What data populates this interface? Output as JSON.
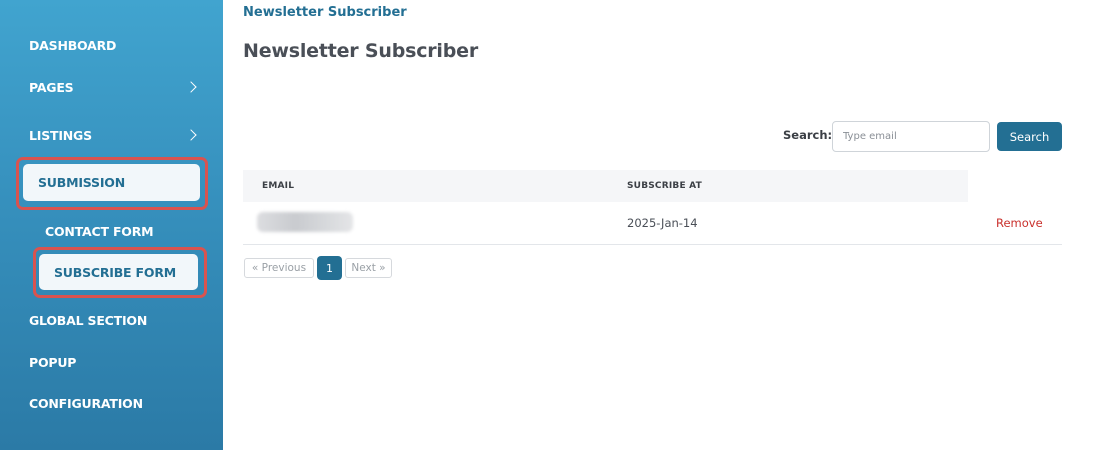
{
  "sidebar": {
    "items": [
      {
        "label": "DASHBOARD"
      },
      {
        "label": "PAGES"
      },
      {
        "label": "LISTINGS"
      },
      {
        "label": "SUBMISSION"
      },
      {
        "label": "GLOBAL SECTION"
      },
      {
        "label": "POPUP"
      },
      {
        "label": "CONFIGURATION"
      }
    ],
    "submission_children": [
      {
        "label": "CONTACT FORM"
      },
      {
        "label": "SUBSCRIBE FORM"
      }
    ]
  },
  "breadcrumb": "Newsletter Subscriber",
  "page_title": "Newsletter Subscriber",
  "search": {
    "label": "Search:",
    "placeholder": "Type email",
    "button": "Search"
  },
  "table": {
    "headers": [
      "EMAIL",
      "SUBSCRIBE AT"
    ],
    "rows": [
      {
        "subscribe_at": "2025-Jan-14",
        "action": "Remove"
      }
    ]
  },
  "pagination": {
    "previous": "« Previous",
    "current": "1",
    "next": "Next »"
  },
  "colors": {
    "primary": "#236f93",
    "sidebar_top": "#41a4cf",
    "sidebar_bottom": "#2b7aa6",
    "highlight": "#d9534f",
    "danger": "#c9302c"
  }
}
